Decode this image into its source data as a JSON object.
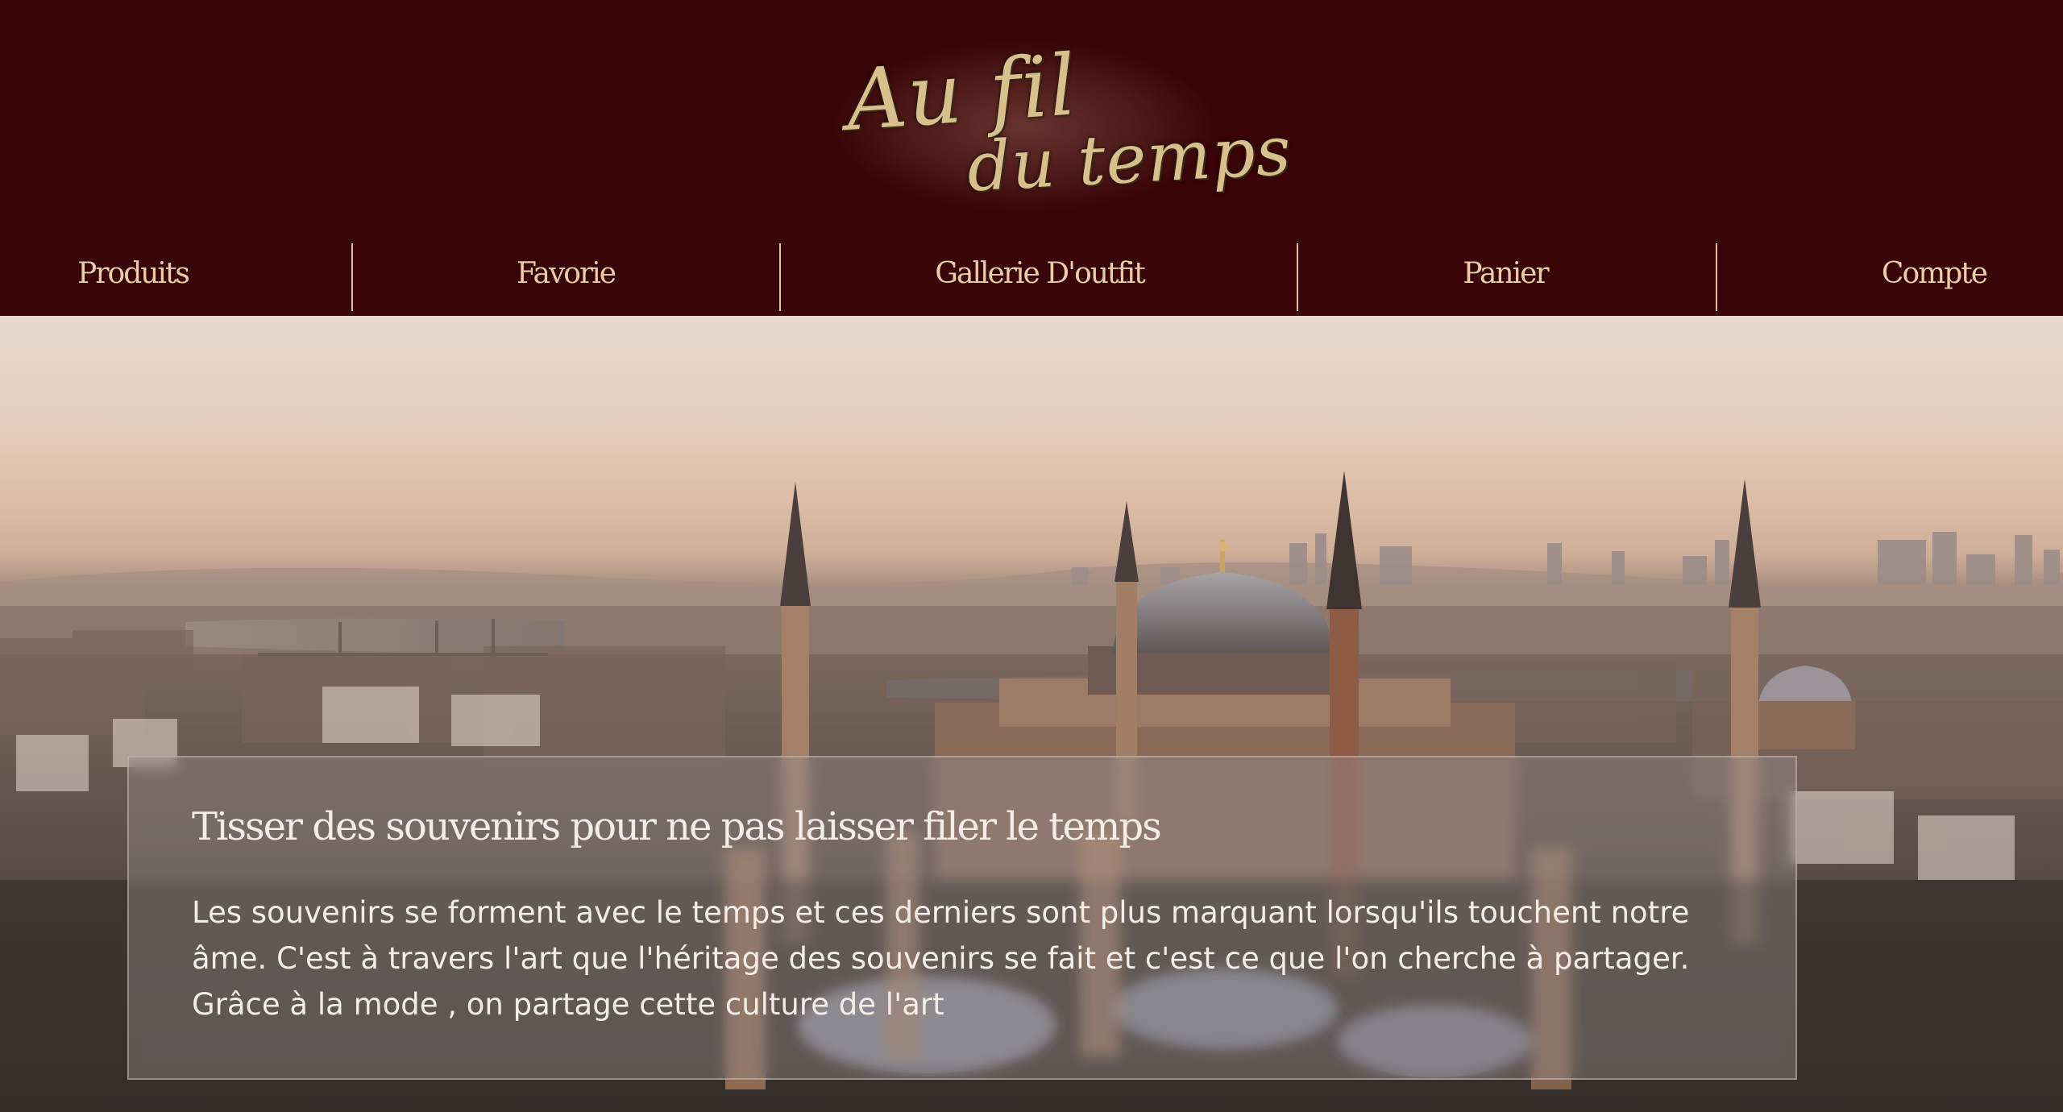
{
  "brand": {
    "logo_line1": "Au fil",
    "logo_line2": "du temps"
  },
  "nav": {
    "items": [
      {
        "label": "Produits"
      },
      {
        "label": "Favorie"
      },
      {
        "label": "Gallerie D'outfit"
      },
      {
        "label": "Panier"
      },
      {
        "label": "Compte"
      }
    ]
  },
  "hero": {
    "title": "Tisser des souvenirs pour ne pas laisser filer le temps",
    "text": "Les souvenirs se forment avec le temps et ces derniers sont plus marquant lorsqu'ils touchent notre âme. C'est à travers l'art que l'héritage des souvenirs se fait et c'est ce que l'on cherche à partager. Grâce à la mode , on partage cette culture de l'art"
  },
  "colors": {
    "header_background": "#3a0508",
    "nav_text": "#e8cfa6",
    "logo_gold": "#d8c08c",
    "card_text": "#f4ece6"
  }
}
